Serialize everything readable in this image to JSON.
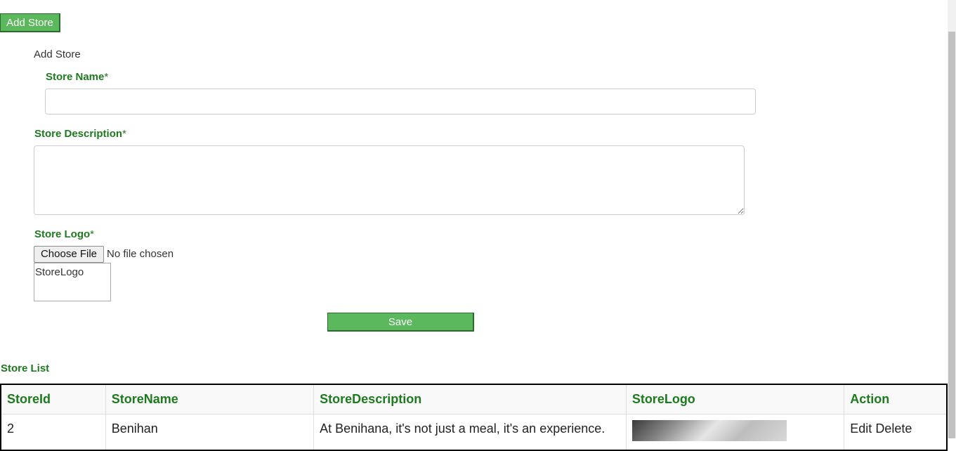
{
  "header": {
    "add_store_button": "Add Store"
  },
  "form": {
    "title": "Add Store",
    "store_name_label": "Store Name",
    "store_description_label": "Store Description",
    "store_logo_label": "Store Logo",
    "required_marker": "*",
    "store_name_value": "",
    "store_description_value": "",
    "choose_file_button": "Choose File",
    "file_status": "No file chosen",
    "logo_preview_alt": "StoreLogo",
    "save_button": "Save"
  },
  "list": {
    "title": "Store List",
    "columns": [
      "StoreId",
      "StoreName",
      "StoreDescription",
      "StoreLogo",
      "Action"
    ],
    "rows": [
      {
        "id": "2",
        "name": "Benihan",
        "description": "At Benihana, it's not just a meal, it's an experience.",
        "edit": "Edit",
        "delete": "Delete"
      }
    ]
  },
  "colors": {
    "accent": "#5cb85c",
    "label": "#1e7a1e"
  }
}
